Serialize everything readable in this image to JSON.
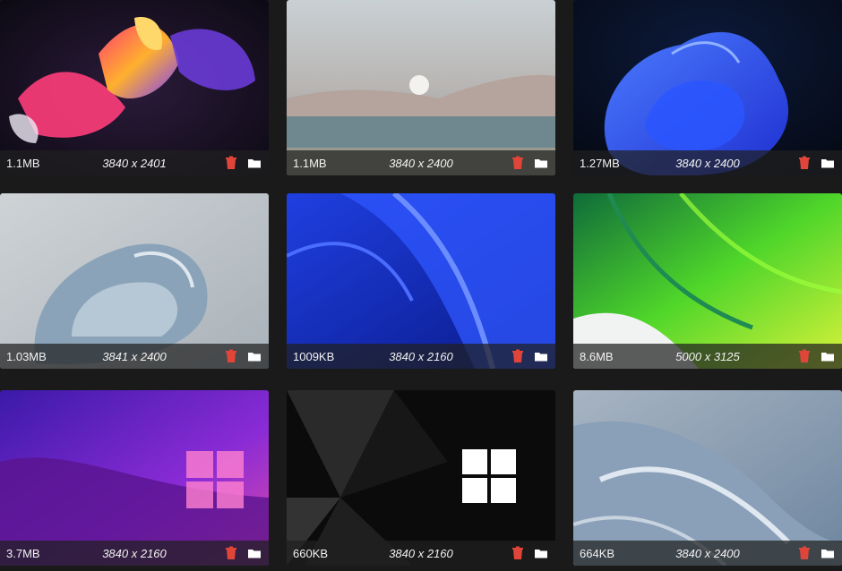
{
  "wallpapers": [
    {
      "size": "1.1MB",
      "dims": "3840 x 2401"
    },
    {
      "size": "1.1MB",
      "dims": "3840 x 2400"
    },
    {
      "size": "1.27MB",
      "dims": "3840 x 2400"
    },
    {
      "size": "1.03MB",
      "dims": "3841 x 2400"
    },
    {
      "size": "1009KB",
      "dims": "3840 x 2160"
    },
    {
      "size": "8.6MB",
      "dims": "5000 x 3125"
    },
    {
      "size": "3.7MB",
      "dims": "3840 x 2160"
    },
    {
      "size": "660KB",
      "dims": "3840 x 2160"
    },
    {
      "size": "664KB",
      "dims": "3840 x 2400"
    }
  ],
  "icons": {
    "delete": "trash-icon",
    "open": "folder-icon"
  },
  "colors": {
    "delete_icon": "#e0453a",
    "open_icon": "#ffffff",
    "bar_text": "#f2f2f2"
  }
}
